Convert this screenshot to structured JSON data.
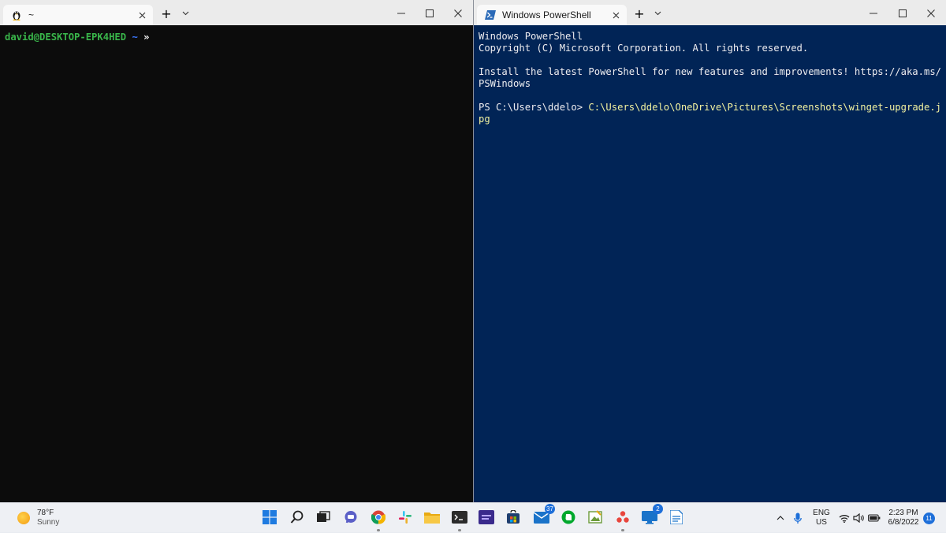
{
  "left_window": {
    "tab_title": "~",
    "terminal": {
      "user_host": "david@DESKTOP-EPK4HED",
      "path": "~",
      "arrow": "»"
    }
  },
  "right_window": {
    "tab_title": "Windows PowerShell",
    "terminal": {
      "line1": "Windows PowerShell",
      "line2": "Copyright (C) Microsoft Corporation. All rights reserved.",
      "line3": "Install the latest PowerShell for new features and improvements! https://aka.ms/PSWindows",
      "prompt": "PS C:\\Users\\ddelo> ",
      "command": "C:\\Users\\ddelo\\OneDrive\\Pictures\\Screenshots\\winget-upgrade.jpg"
    }
  },
  "titlebar_glyphs": {
    "new_tab": "+",
    "dropdown": "⌄",
    "minimize": "—",
    "maximize": "☐",
    "close": "✕"
  },
  "weather": {
    "temperature": "78°F",
    "condition": "Sunny"
  },
  "taskbar_badges": {
    "mail": "37",
    "remote_desktop": "2"
  },
  "tray": {
    "language": "ENG",
    "region": "US",
    "time": "2:23 PM",
    "date": "6/8/2022",
    "notifications": "11"
  },
  "colors": {
    "linux_bg": "#0c0c0c",
    "powershell_bg": "#012456",
    "prompt_green": "#39b54a",
    "prompt_blue": "#3b78ff",
    "accent": "#1e6fd9"
  }
}
